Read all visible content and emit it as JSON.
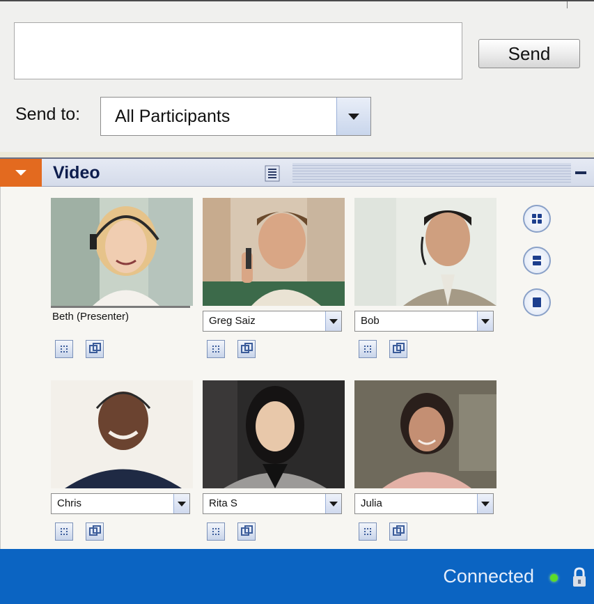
{
  "chat": {
    "message_value": "",
    "send_label": "Send",
    "send_to_label": "Send to:",
    "send_to_selected": "All Participants"
  },
  "video_pod": {
    "title": "Video",
    "participants": [
      {
        "name": "Beth (Presenter)",
        "is_presenter": true
      },
      {
        "name": "Greg Saiz"
      },
      {
        "name": "Bob"
      },
      {
        "name": "Chris"
      },
      {
        "name": "Rita S"
      },
      {
        "name": "Julia"
      }
    ],
    "layout_buttons": [
      "grid-4-layout-icon",
      "grid-2-layout-icon",
      "single-layout-icon"
    ]
  },
  "status": {
    "text": "Connected",
    "indicator_color": "#5cdc2a"
  },
  "colors": {
    "accent_orange": "#e36a1f",
    "status_blue": "#0b64c2"
  }
}
